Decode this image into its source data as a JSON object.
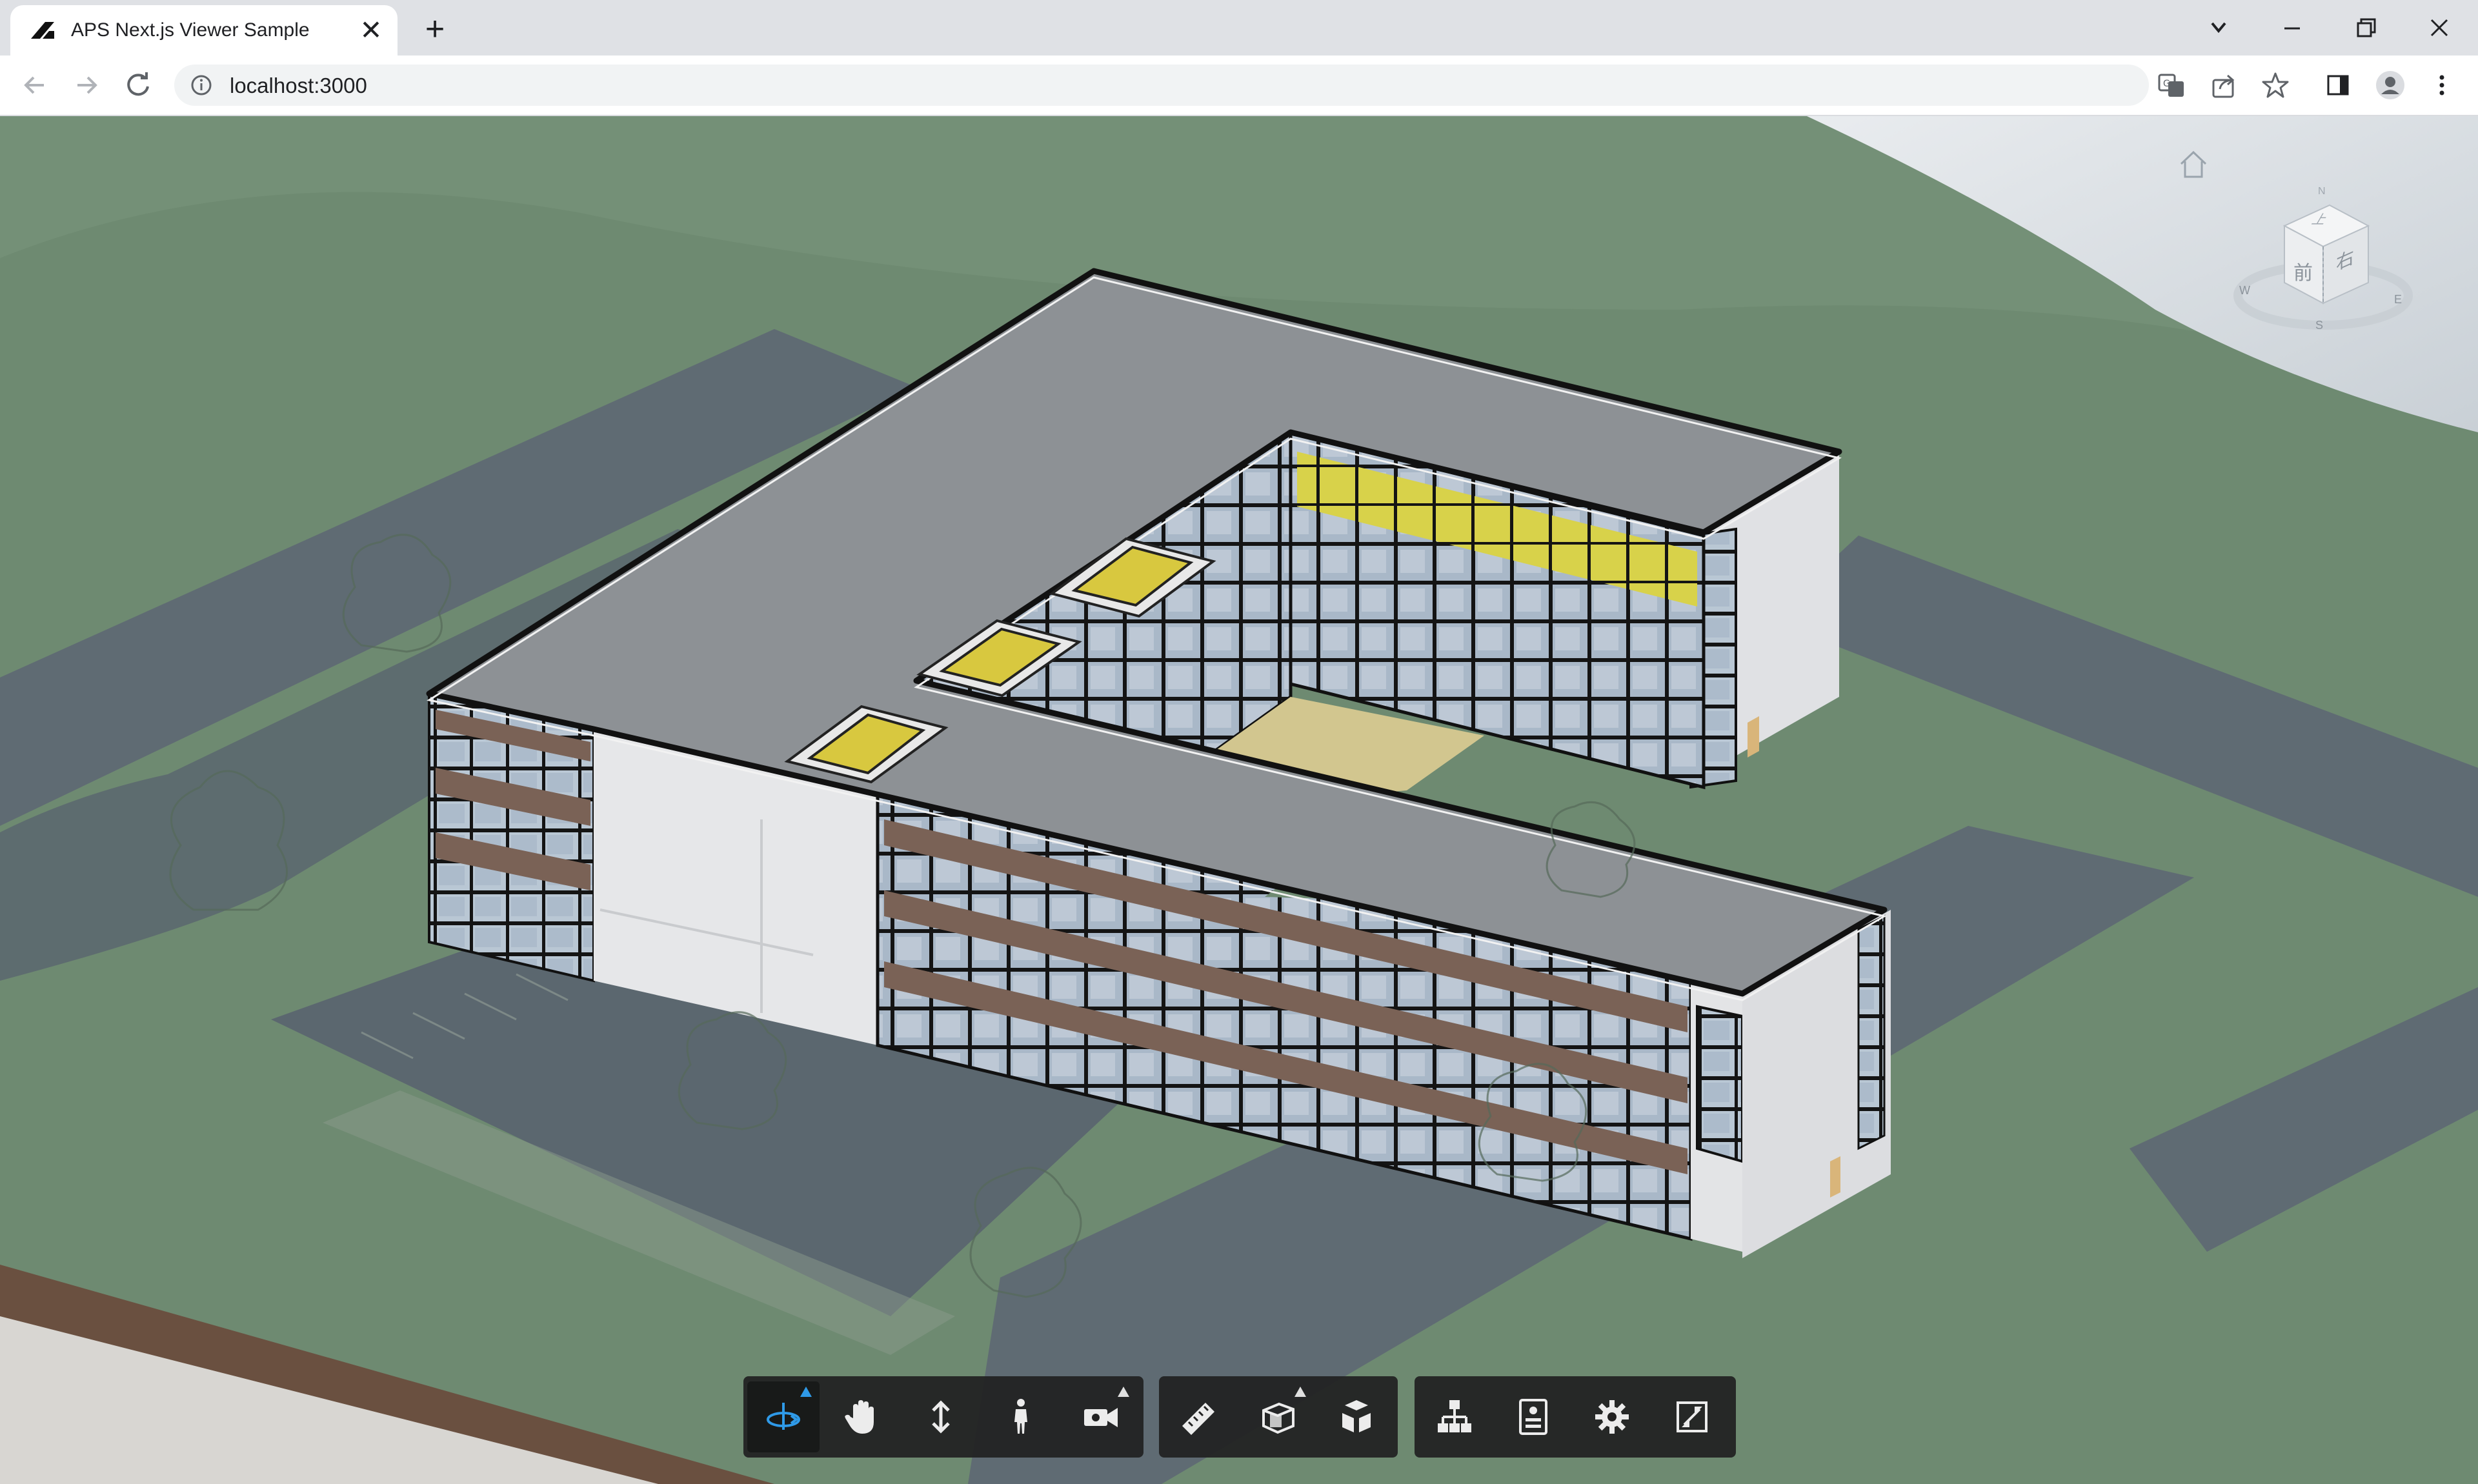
{
  "browser": {
    "tab_title": "APS Next.js Viewer Sample",
    "url": "localhost:3000",
    "close_glyph": "✕",
    "new_tab_glyph": "+"
  },
  "viewcube": {
    "face_front": "前",
    "face_right": "右",
    "face_top": "上",
    "compass_n": "N",
    "compass_s": "S",
    "compass_e": "E",
    "compass_w": "W"
  },
  "toolbar": {
    "groups": [
      {
        "name": "navigation",
        "tools": [
          "orbit-icon",
          "pan-icon",
          "zoom-icon",
          "first-person-icon",
          "camera-icon"
        ]
      },
      {
        "name": "modeling",
        "tools": [
          "measure-icon",
          "section-icon",
          "explode-icon"
        ]
      },
      {
        "name": "settings",
        "tools": [
          "model-browser-icon",
          "properties-icon",
          "settings-icon",
          "fullscreen-icon"
        ]
      }
    ],
    "active_tool": "orbit-icon"
  },
  "colors": {
    "ground": "#6f8b72",
    "road": "#5f6b73",
    "roof": "#8c9094",
    "accent_blue": "#2f9ae8",
    "toolbar_bg": "#222222"
  }
}
